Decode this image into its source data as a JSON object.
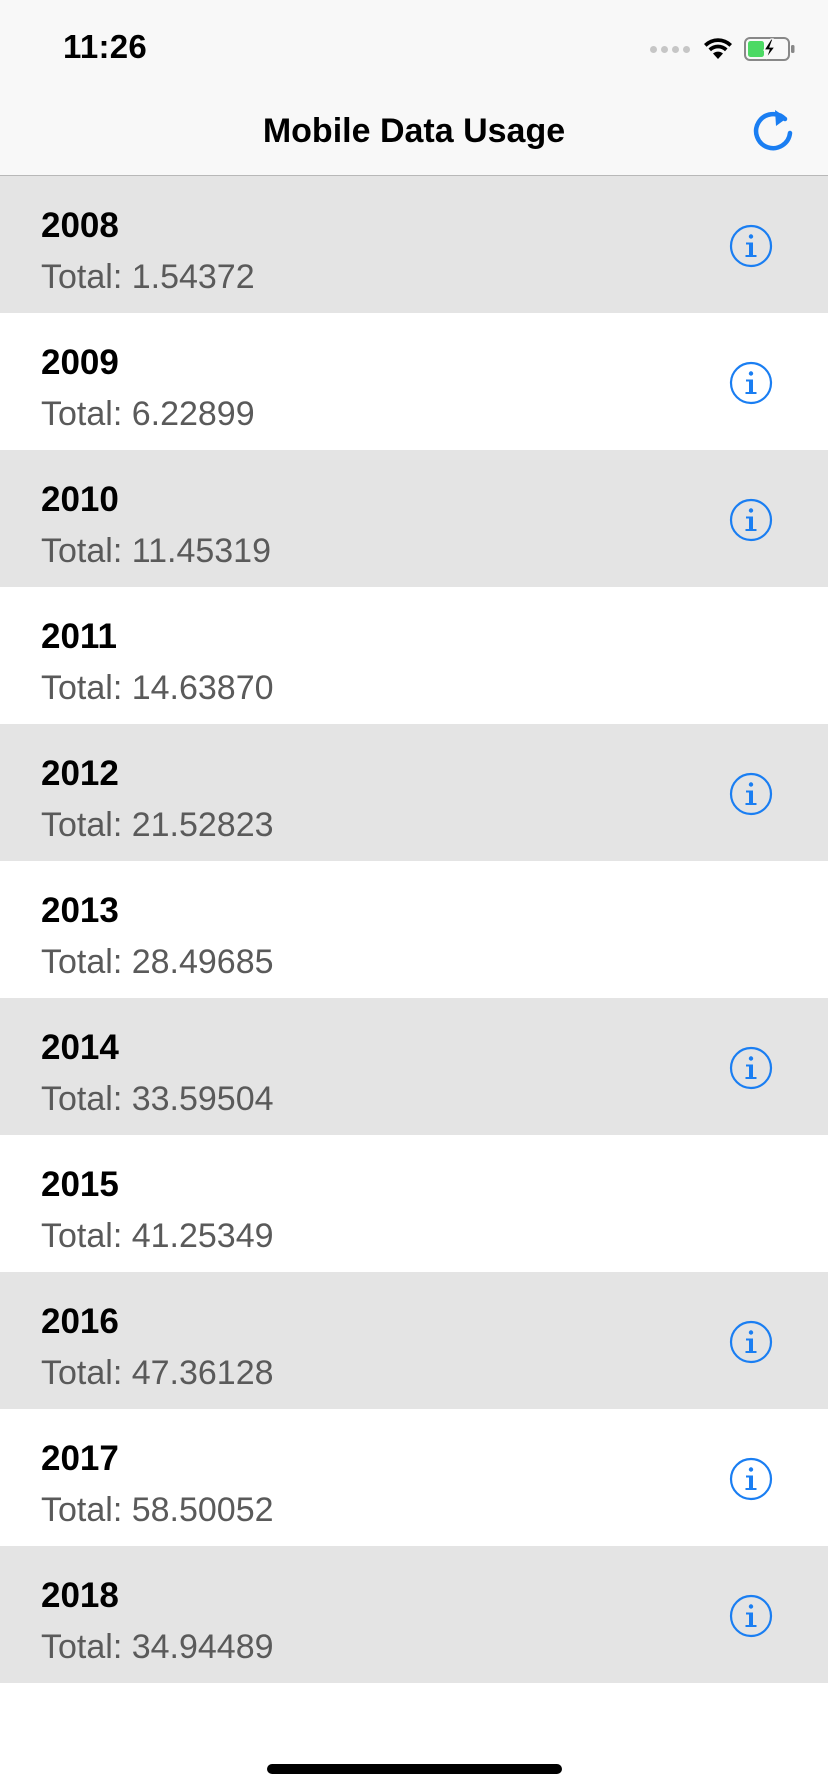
{
  "status_bar": {
    "time": "11:26"
  },
  "nav": {
    "title": "Mobile Data Usage",
    "refresh_icon": "refresh-icon"
  },
  "colors": {
    "accent": "#1a7ef2",
    "row_shaded": "#e4e4e4",
    "row_plain": "#ffffff",
    "battery_green": "#4cd964"
  },
  "rows": [
    {
      "year": "2008",
      "total": "Total: 1.54372",
      "has_info": true
    },
    {
      "year": "2009",
      "total": "Total: 6.22899",
      "has_info": true
    },
    {
      "year": "2010",
      "total": "Total: 11.45319",
      "has_info": true
    },
    {
      "year": "2011",
      "total": "Total: 14.63870",
      "has_info": false
    },
    {
      "year": "2012",
      "total": "Total: 21.52823",
      "has_info": true
    },
    {
      "year": "2013",
      "total": "Total: 28.49685",
      "has_info": false
    },
    {
      "year": "2014",
      "total": "Total: 33.59504",
      "has_info": true
    },
    {
      "year": "2015",
      "total": "Total: 41.25349",
      "has_info": false
    },
    {
      "year": "2016",
      "total": "Total: 47.36128",
      "has_info": true
    },
    {
      "year": "2017",
      "total": "Total: 58.50052",
      "has_info": true
    },
    {
      "year": "2018",
      "total": "Total: 34.94489",
      "has_info": true
    }
  ]
}
